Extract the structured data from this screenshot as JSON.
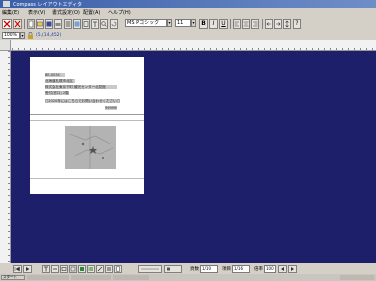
{
  "window": {
    "title": "Compass レイアウトエディタ"
  },
  "menu": [
    "編集(E)",
    "表示(V)",
    "書式設定(O)",
    "配置(A)",
    "ヘルプ(H)"
  ],
  "toolbar": {
    "font_name": "MS Pゴシック",
    "font_size": "11",
    "bold": "B",
    "italic": "I",
    "underline": "U",
    "help": "?"
  },
  "toolbar2": {
    "zoom_value": "100%",
    "coordinate_text": "(5,(14,452)"
  },
  "document": {
    "line1": "BE-0034",
    "line2": "北海道札幌市北区",
    "line3": "株式会社東京下町 観光センター北見館",
    "line4": "受付(窓口) 2階",
    "line5": "□2020年にはこちらでお問い合わせください□",
    "line6": "9999999"
  },
  "bottom_bar": {
    "page_label": "頁数",
    "page_value": "1/10",
    "item_label": "項目",
    "item_value": "1/16",
    "zoom_label": "倍率",
    "zoom_value": "100"
  },
  "taskbar": {
    "start": "スタート"
  }
}
